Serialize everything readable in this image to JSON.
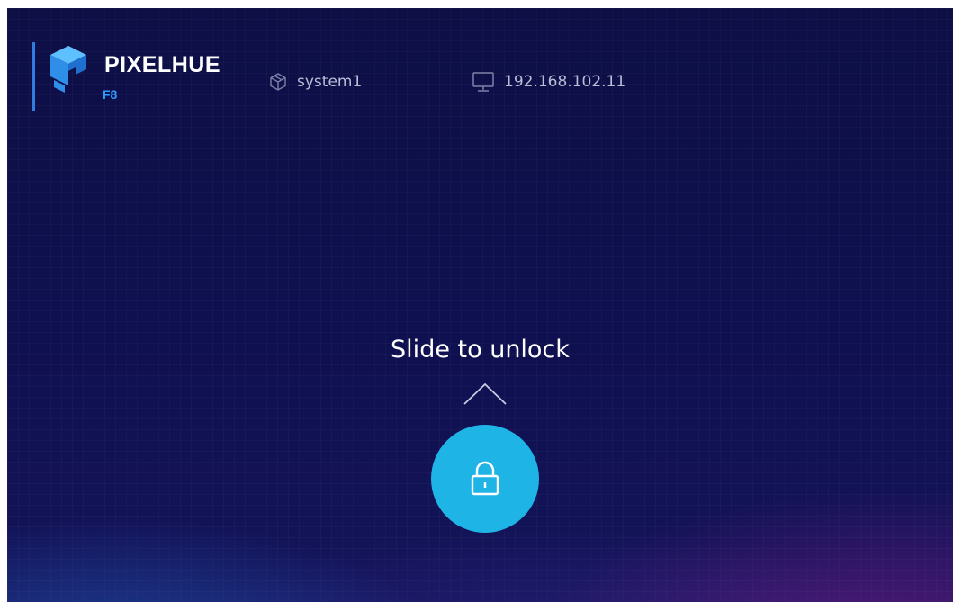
{
  "header": {
    "brand": "PIXELHUE",
    "model": "F8",
    "system_name": "system1",
    "ip_address": "192.168.102.11",
    "icons": {
      "logo": "pixelhue-logo-icon",
      "system": "cube-icon",
      "ip": "monitor-icon"
    }
  },
  "unlock": {
    "prompt": "Slide to unlock",
    "chevron_icon": "chevron-up-icon",
    "lock_icon": "lock-icon"
  },
  "colors": {
    "background": "#0f1050",
    "accent_blue": "#2f7de1",
    "model_blue": "#2f9bff",
    "lock_button": "#1fb4e6",
    "info_text": "#b9bdd6"
  }
}
